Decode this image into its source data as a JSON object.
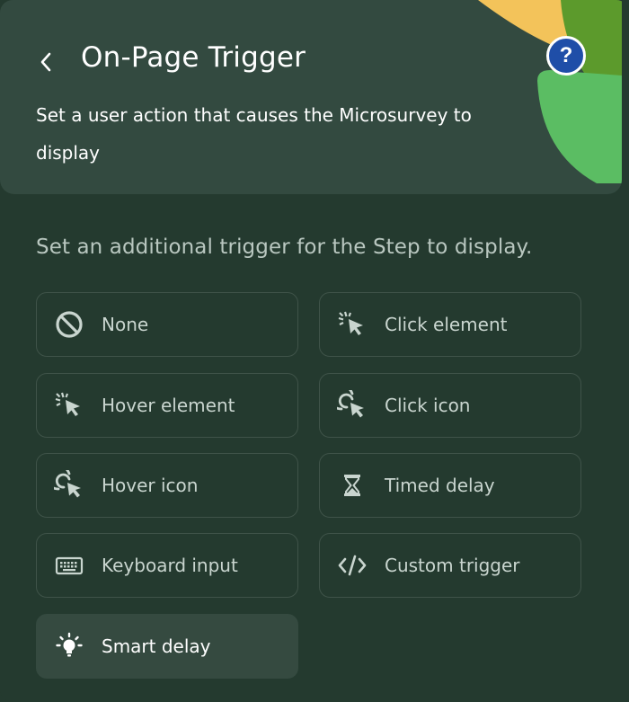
{
  "header": {
    "title": "On-Page Trigger",
    "subtitle": "Set a user action that causes the Microsurvey to display",
    "help": "?",
    "colors": {
      "accent_yellow": "#f3c35a",
      "accent_green": "#5bbd63",
      "accent_dark_green": "#5c9a2c",
      "help_blue": "#1f4ea8"
    }
  },
  "prompt": "Set an additional trigger for the Step to display.",
  "options": [
    {
      "label": "None",
      "icon": "none-icon"
    },
    {
      "label": "Click element",
      "icon": "click-element-icon"
    },
    {
      "label": "Hover element",
      "icon": "hover-element-icon"
    },
    {
      "label": "Click icon",
      "icon": "click-icon-icon"
    },
    {
      "label": "Hover icon",
      "icon": "hover-icon-icon"
    },
    {
      "label": "Timed delay",
      "icon": "hourglass-icon"
    },
    {
      "label": "Keyboard input",
      "icon": "keyboard-icon"
    },
    {
      "label": "Custom trigger",
      "icon": "code-icon"
    },
    {
      "label": "Smart delay",
      "icon": "lightbulb-icon",
      "selected": true
    }
  ]
}
